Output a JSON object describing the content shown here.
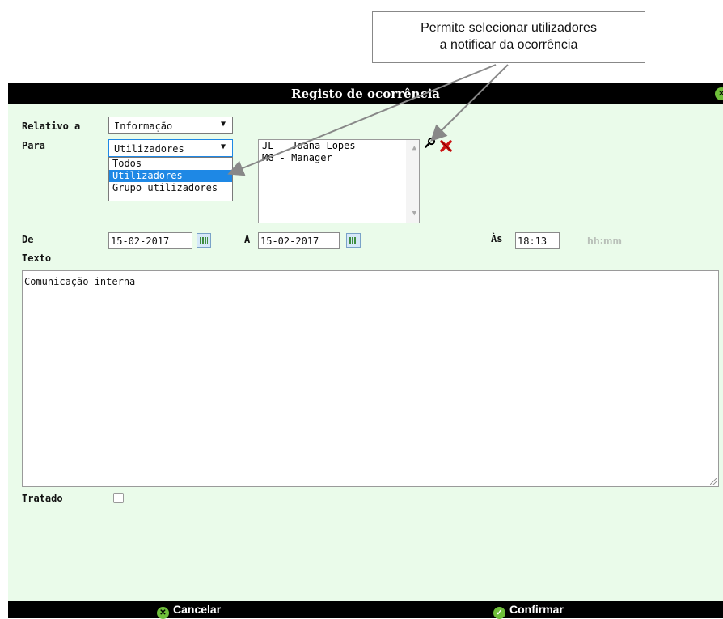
{
  "callout": {
    "line1": "Permite selecionar utilizadores",
    "line2": "a notificar da ocorrência"
  },
  "dialog": {
    "title": "Registo de ocorrência",
    "close_icon": "close-circle-icon"
  },
  "form": {
    "relativo_label": "Relativo a",
    "relativo_value": "Informação",
    "para_label": "Para",
    "para_value": "Utilizadores",
    "para_options": [
      "Todos",
      "Utilizadores",
      "Grupo utilizadores"
    ],
    "selected_users": [
      "JL - Joana Lopes",
      "MG - Manager"
    ],
    "search_icon": "magnifier-icon",
    "remove_icon": "red-x-icon",
    "de_label": "De",
    "de_value": "15-02-2017",
    "a_label": "A",
    "a_value": "15-02-2017",
    "as_label": "Às",
    "as_value": "18:13",
    "time_hint": "hh:mm",
    "texto_label": "Texto",
    "texto_value": "Comunicação interna",
    "tratado_label": "Tratado",
    "tratado_checked": false
  },
  "footer": {
    "cancel_label": "Cancelar",
    "confirm_label": "Confirmar"
  },
  "colors": {
    "dialog_bg": "#eafbea",
    "bar_bg": "#000000",
    "selection": "#1e88e5",
    "confirm_icon": "#6fbf3a",
    "remove_icon": "#cc1111"
  }
}
